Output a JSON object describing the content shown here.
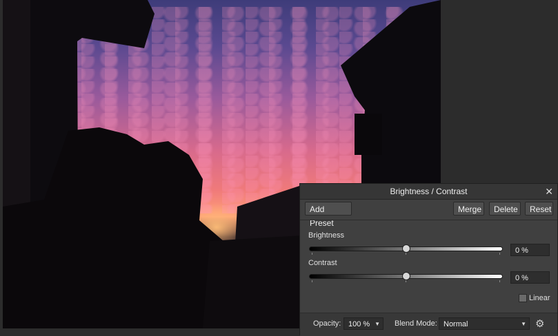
{
  "panel": {
    "title": "Brightness / Contrast",
    "close_label": "✕",
    "buttons": {
      "add_preset": "Add Preset",
      "merge": "Merge",
      "delete": "Delete",
      "reset": "Reset"
    },
    "brightness": {
      "label": "Brightness",
      "value_text": "0 %",
      "value": 0
    },
    "contrast": {
      "label": "Contrast",
      "value_text": "0 %",
      "value": 0
    },
    "linear": {
      "label": "Linear",
      "checked": false
    },
    "footer": {
      "opacity_label": "Opacity:",
      "opacity_value": "100 %",
      "blend_label": "Blend Mode:",
      "blend_value": "Normal",
      "settings_icon": "gear-icon"
    }
  }
}
